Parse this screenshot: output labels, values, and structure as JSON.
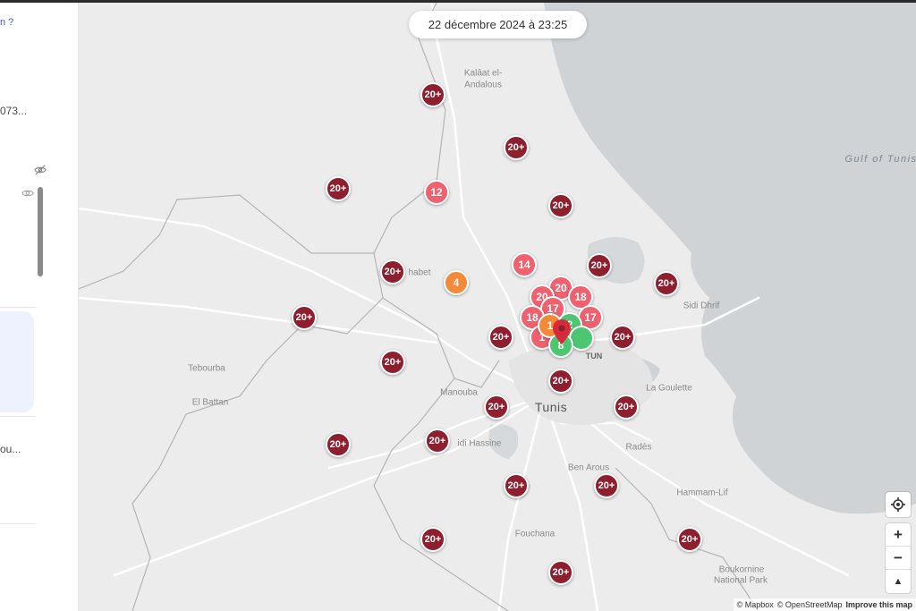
{
  "sidebar": {
    "link_fragment": "n ?",
    "text_fragment_1": "073...",
    "text_fragment_2": "ou...",
    "icons": [
      "eye-off-icon",
      "eye-icon"
    ]
  },
  "map": {
    "timestamp": "22 décembre 2024 à 23:25",
    "places": [
      {
        "name": "Kalâat el-",
        "type": "town"
      },
      {
        "name": "Andalous",
        "type": "town"
      },
      {
        "name": "Gulf of Tunis",
        "type": "sea"
      },
      {
        "name": "habet",
        "type": "town"
      },
      {
        "name": "Sidi Dhrif",
        "type": "town"
      },
      {
        "name": "TUN",
        "type": "small"
      },
      {
        "name": "Tebourba",
        "type": "town"
      },
      {
        "name": "El Battan",
        "type": "town"
      },
      {
        "name": "Manouba",
        "type": "town"
      },
      {
        "name": "Tunis",
        "type": "city"
      },
      {
        "name": "La Goulette",
        "type": "town"
      },
      {
        "name": "idi Hassine",
        "type": "town"
      },
      {
        "name": "Radès",
        "type": "town"
      },
      {
        "name": "Ben Arous",
        "type": "town"
      },
      {
        "name": "Hammam-Lif",
        "type": "town"
      },
      {
        "name": "Fouchana",
        "type": "town"
      },
      {
        "name": "Boukornine",
        "type": "town"
      },
      {
        "name": "National Park",
        "type": "town"
      }
    ],
    "clusters": [
      {
        "label": "20+",
        "color": "dark"
      },
      {
        "label": "20+",
        "color": "dark"
      },
      {
        "label": "20+",
        "color": "dark"
      },
      {
        "label": "12",
        "color": "pink"
      },
      {
        "label": "20+",
        "color": "dark"
      },
      {
        "label": "14",
        "color": "pink"
      },
      {
        "label": "20+",
        "color": "dark"
      },
      {
        "label": "20+",
        "color": "dark"
      },
      {
        "label": "4",
        "color": "orange"
      },
      {
        "label": "20+",
        "color": "dark"
      },
      {
        "label": "20+",
        "color": "dark"
      },
      {
        "label": "20",
        "color": "pink"
      },
      {
        "label": "20",
        "color": "pink"
      },
      {
        "label": "18",
        "color": "pink"
      },
      {
        "label": "17",
        "color": "pink"
      },
      {
        "label": "18",
        "color": "pink"
      },
      {
        "label": "17",
        "color": "pink"
      },
      {
        "label": "1",
        "color": "pink"
      },
      {
        "label": "1",
        "color": "orange"
      },
      {
        "label": "2",
        "color": "green"
      },
      {
        "label": "",
        "color": "green"
      },
      {
        "label": "8",
        "color": "green"
      },
      {
        "label": "20+",
        "color": "dark"
      },
      {
        "label": "20+",
        "color": "dark"
      },
      {
        "label": "20+",
        "color": "dark"
      },
      {
        "label": "20+",
        "color": "dark"
      },
      {
        "label": "20+",
        "color": "dark"
      },
      {
        "label": "20+",
        "color": "dark"
      },
      {
        "label": "20+",
        "color": "dark"
      },
      {
        "label": "20+",
        "color": "dark"
      },
      {
        "label": "20+",
        "color": "dark"
      },
      {
        "label": "20+",
        "color": "dark"
      },
      {
        "label": "20+",
        "color": "dark"
      }
    ],
    "controls": {
      "locate_icon": "crosshair-icon",
      "zoom_in": "+",
      "zoom_out": "−",
      "compass": "▲"
    },
    "attribution": {
      "mapbox": "© Mapbox",
      "osm": "© OpenStreetMap",
      "improve": "Improve this map"
    },
    "colors": {
      "dark": "#8e1f2e",
      "pink": "#f0616f",
      "orange": "#f28a3a",
      "green": "#4cc771",
      "water": "#cfd3d6",
      "land": "#ececec"
    }
  }
}
